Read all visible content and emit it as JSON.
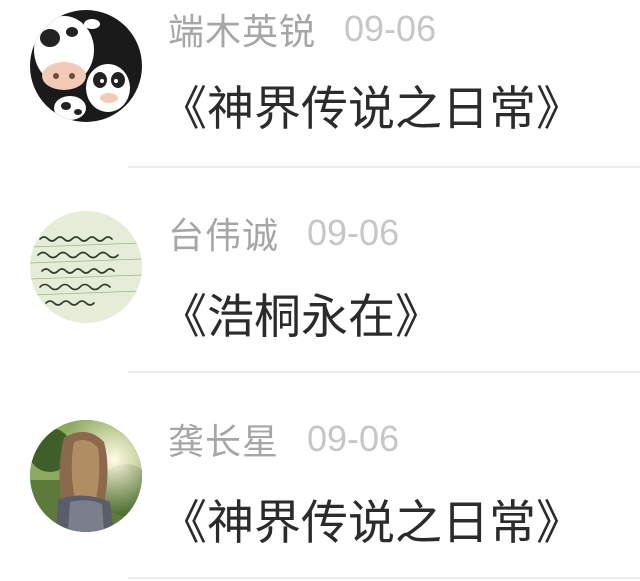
{
  "comments": [
    {
      "author": "端木英锐",
      "date": "09-06",
      "title": "《神界传说之日常》",
      "avatar_icon": "cartoon-cow-avatar"
    },
    {
      "author": "台伟诚",
      "date": "09-06",
      "title": "《浩桐永在》",
      "avatar_icon": "handwriting-paper-avatar"
    },
    {
      "author": "龚长星",
      "date": "09-06",
      "title": "《神界传说之日常》",
      "avatar_icon": "girl-photo-avatar"
    }
  ],
  "colors": {
    "author": "#a6a6a6",
    "date": "#c6c6c6",
    "title": "#2b2b2b",
    "divider": "#ededed"
  }
}
